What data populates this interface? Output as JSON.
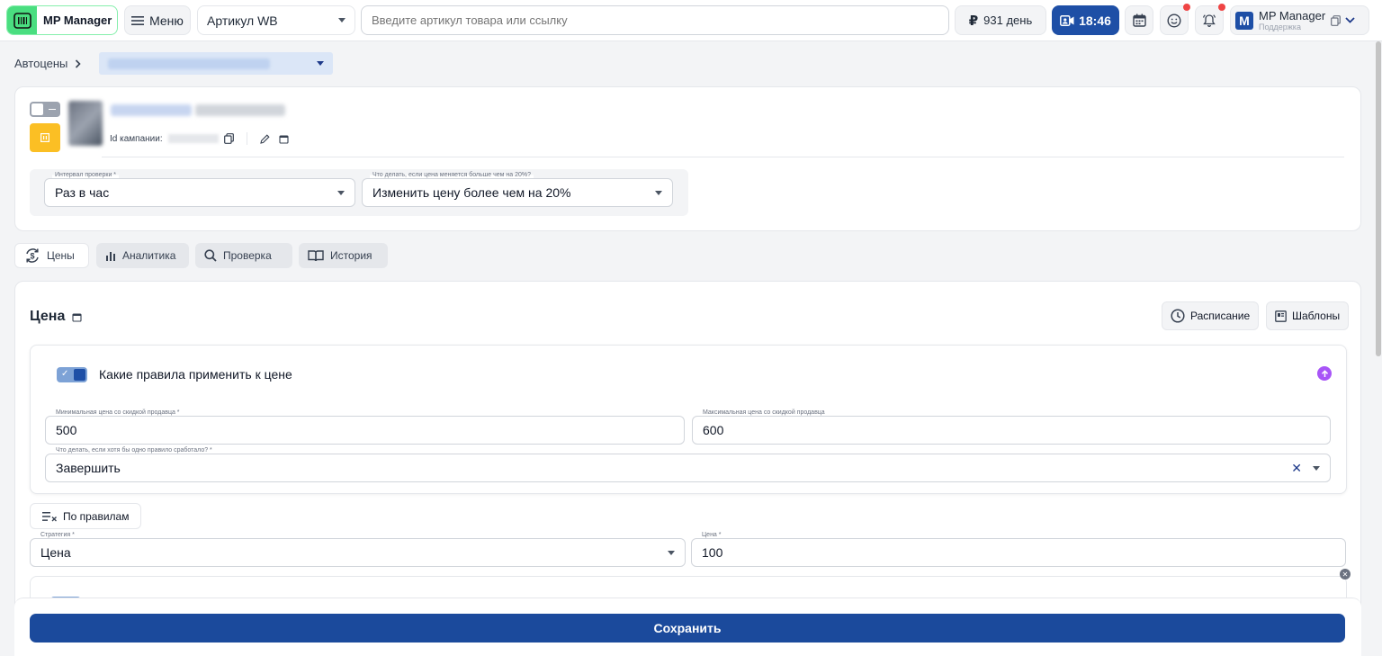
{
  "topbar": {
    "logo_text": "MP Manager",
    "menu_label": "Меню",
    "article_select": "Артикул WB",
    "search_placeholder": "Введите артикул товара или ссылку",
    "balance": "931 день",
    "time": "18:46",
    "user_name": "MP Manager",
    "user_sub": "Поддержка",
    "user_initial": "M"
  },
  "breadcrumb": {
    "root": "Автоцены"
  },
  "campaign": {
    "id_label": "Id кампании:",
    "interval_label": "Интервал проверки *",
    "interval_value": "Раз в час",
    "change_label": "Что делать, если цена меняется больше чем на 20%?",
    "change_value": "Изменить цену более чем на 20%"
  },
  "tabs": [
    {
      "label": "Цены",
      "icon": "dollar-refresh-icon"
    },
    {
      "label": "Аналитика",
      "icon": "bar-chart-icon"
    },
    {
      "label": "Проверка",
      "icon": "search-icon"
    },
    {
      "label": "История",
      "icon": "book-icon"
    }
  ],
  "price": {
    "title": "Цена",
    "schedule_btn": "Расписание",
    "templates_btn": "Шаблоны",
    "rules_title": "Какие правила применить к цене",
    "min_label": "Минимальная цена со скидкой продавца *",
    "min_value": "500",
    "max_label": "Максимальная цена со скидкой продавца",
    "max_value": "600",
    "action_label": "Что делать, если хотя бы одно правило сработало? *",
    "action_value": "Завершить",
    "by_rules_btn": "По правилам",
    "strategy_label": "Стратегия *",
    "strategy_value": "Цена",
    "price_label": "Цена *",
    "price_value": "100"
  },
  "save_label": "Сохранить",
  "colors": {
    "primary": "#1b4a9c",
    "logo_green": "#4ade80",
    "orange": "#fbbf24",
    "purple": "#a855f7",
    "notify_red": "#ef4444"
  }
}
